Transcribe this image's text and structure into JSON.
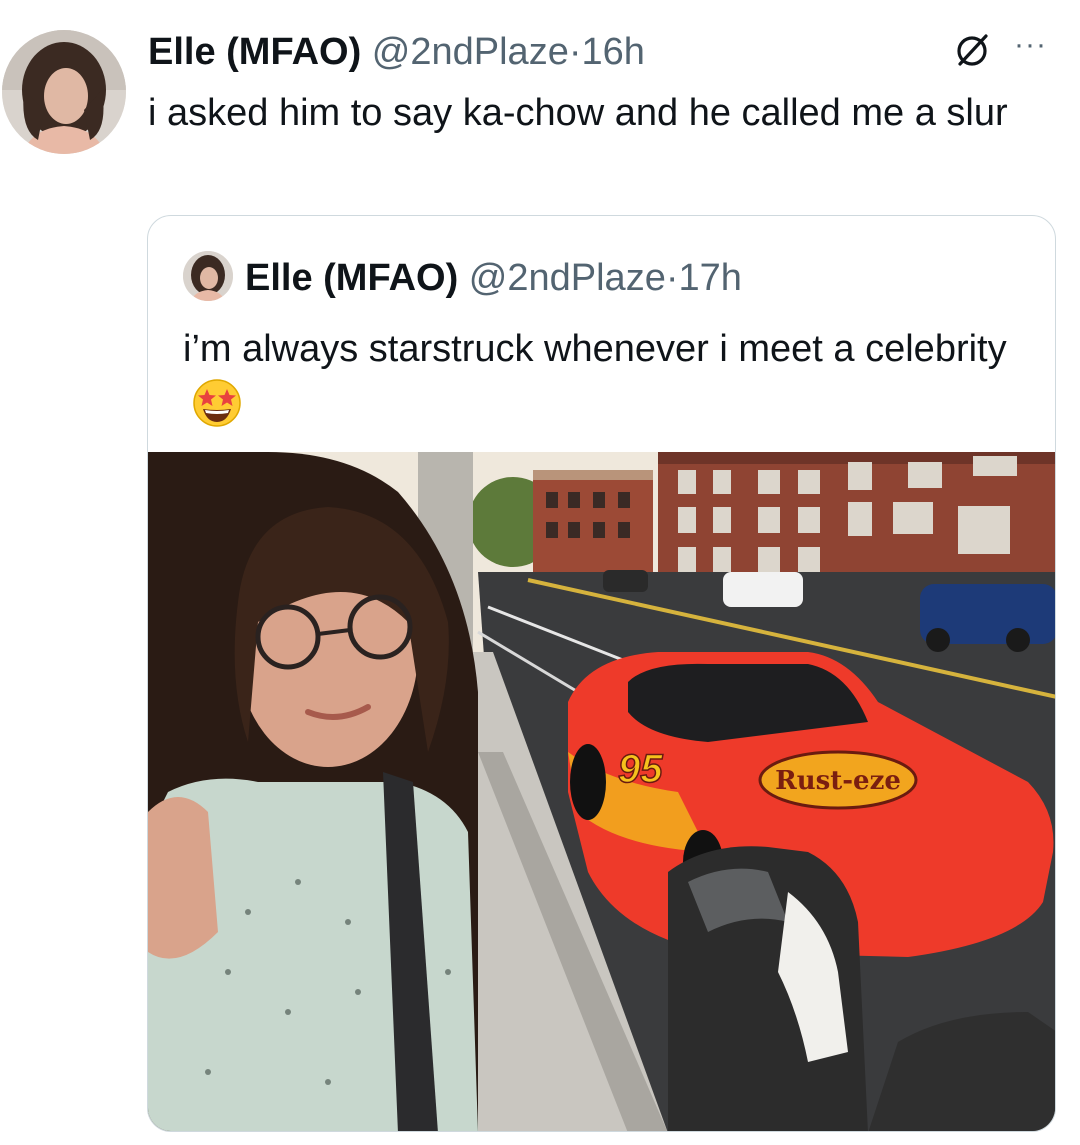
{
  "tweet": {
    "author_name": "Elle (MFAO)",
    "handle": "@2ndPlaze",
    "separator": "·",
    "time": "16h",
    "text": "i asked him to say ka-chow and he called me a slur",
    "avatar_icon": "profile-avatar",
    "grok_icon": "grok-icon",
    "more_icon": "more-options-icon",
    "more_glyph": "···"
  },
  "quoted_tweet": {
    "author_name": "Elle (MFAO)",
    "handle": "@2ndPlaze",
    "separator": "·",
    "time": "17h",
    "text": "i’m always starstruck whenever i meet a celebrity",
    "emoji": "star-struck-emoji",
    "photo": {
      "car_decal": "Rust-eze",
      "car_number": "95",
      "car_color": "#ee3a2a"
    }
  }
}
